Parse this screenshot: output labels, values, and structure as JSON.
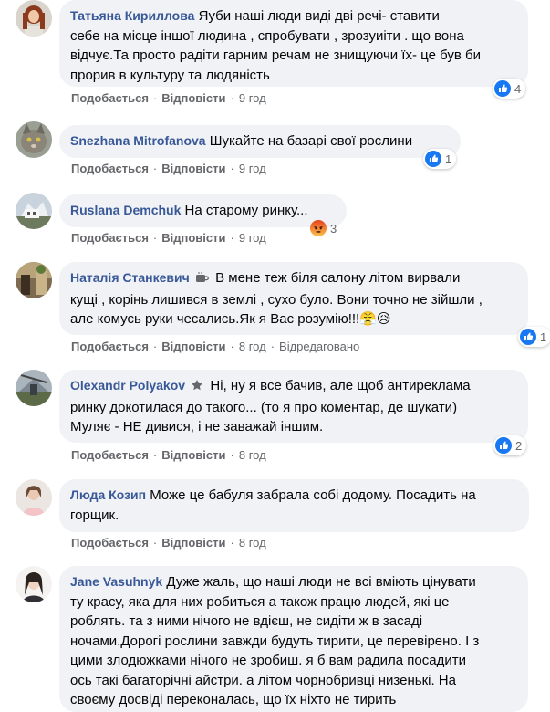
{
  "actions": {
    "like": "Подобається",
    "reply": "Відповісти",
    "edited": "Відредаговано"
  },
  "colors": {
    "author": "#385898",
    "bubble": "#f0f2f5",
    "meta": "#65676b",
    "like_blue": "#1877f2",
    "angry": "#f0592a"
  },
  "comments": [
    {
      "author": "Татьяна Кириллова",
      "text_lines": [
        "Яуби наші люди виді дві речі- ставити",
        "себе на місце іншої людина , спробувати , зрозуиіти . що вона",
        "відчує.Та просто радіти гарним речам не знищуючи їх- це був би",
        "прорив в культуру та людяність"
      ],
      "time": "9 год",
      "reaction_icon": "like-icon",
      "reaction_count": "4"
    },
    {
      "author": "Snezhana Mitrofanova",
      "text_lines": [
        "Шукайте на базарі свої рослини"
      ],
      "time": "9 год",
      "reaction_icon": "like-icon",
      "reaction_count": "1"
    },
    {
      "author": "Ruslana Demchuk",
      "text_lines": [
        "На старому ринку..."
      ],
      "time": "9 год",
      "reaction_icon": "angry-icon",
      "reaction_count": "3"
    },
    {
      "author": "Наталія Станкевич",
      "author_badge_icon": "coffee-cup-icon",
      "text_lines": [
        "В мене теж біля салону літом вирвали",
        "кущі , корінь лишився в землі , сухо було. Вони точно не зійшли ,",
        "але комусь руки чесались.Як я Вас розумію!!!😤😥"
      ],
      "time": "8 год",
      "edited": true,
      "reaction_icon": "like-icon",
      "reaction_count": "1"
    },
    {
      "author": "Olexandr Polyakov",
      "author_badge_icon": "star-icon",
      "text_lines": [
        "Ні, ну я все бачив, але щоб антиреклама",
        "ринку докотилася до такого... (то я про коментар, де шукати)",
        "Муляє - НЕ дивися, і не заважай іншим."
      ],
      "time": "8 год",
      "reaction_icon": "like-icon",
      "reaction_count": "2"
    },
    {
      "author": "Люда Козип",
      "text_lines": [
        "Може це бабуля забрала собі додому. Посадить на",
        "горщик."
      ],
      "time": "8 год"
    },
    {
      "author": "Jane Vasuhnyk",
      "text_lines": [
        "Дуже жаль, що наші люди не всі вміють цінувати",
        "ту красу, яка для них робиться а також працю людей, які це",
        "роблять. та з ними нічого не вдієш, не сидіти ж в засаді",
        "ночами.Дорогі рослини завжди будуть тирити, це перевірено. І з",
        "цими злодюжками нічого не зробиш. я б вам радила посадити",
        "ось такі багаторічні айстри. а літом чорнобривці низенькі. На",
        "своєму досвіді переконалась, що їх ніхто не тирить"
      ]
    }
  ]
}
